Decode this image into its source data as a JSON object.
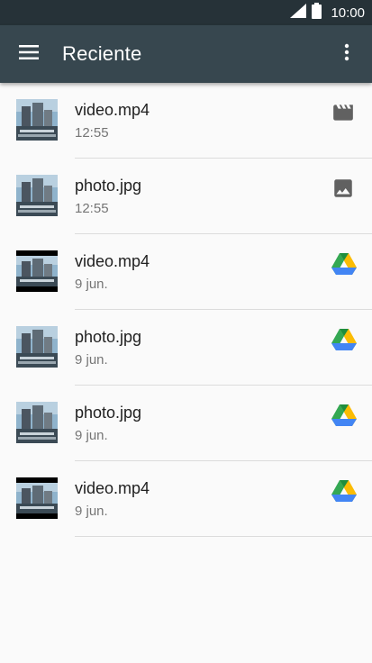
{
  "status_bar": {
    "time": "10:00",
    "icons": [
      "signal-icon",
      "battery-icon"
    ]
  },
  "app_bar": {
    "title": "Reciente",
    "left_icon": "menu-icon",
    "right_icon": "more-vert-icon"
  },
  "files": [
    {
      "name": "video.mp4",
      "date": "12:55",
      "type_icon": "movie-icon",
      "thumb": "video-thumbnail"
    },
    {
      "name": "photo.jpg",
      "date": "12:55",
      "type_icon": "image-icon",
      "thumb": "photo-thumbnail"
    },
    {
      "name": "video.mp4",
      "date": "9 jun.",
      "type_icon": "google-drive-icon",
      "thumb": "video-thumbnail"
    },
    {
      "name": "photo.jpg",
      "date": "9 jun.",
      "type_icon": "google-drive-icon",
      "thumb": "photo-thumbnail"
    },
    {
      "name": "photo.jpg",
      "date": "9 jun.",
      "type_icon": "google-drive-icon",
      "thumb": "photo-thumbnail"
    },
    {
      "name": "video.mp4",
      "date": "9 jun.",
      "type_icon": "google-drive-icon",
      "thumb": "video-thumbnail"
    }
  ],
  "colors": {
    "status_bar": "#263238",
    "app_bar": "#37474f",
    "background": "#fafafa",
    "title_text": "#212121",
    "secondary_text": "#757575",
    "icon_grey": "#616161"
  }
}
